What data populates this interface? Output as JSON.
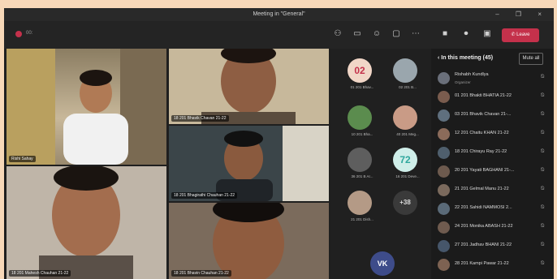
{
  "window": {
    "title": "Meeting in \"General\"",
    "controls": "– ❐ ×"
  },
  "toolbar": {
    "recording_label": "00:",
    "leave_label": "Leave"
  },
  "tiles": [
    {
      "name": "Rishi Sahay"
    },
    {
      "name": "18 201 Bhavik Chavan 21-22"
    },
    {
      "name": "18 201 Bhagirathi Chauhan 21-22"
    },
    {
      "name": "18 201 Mahesh Chauhan 21-22"
    },
    {
      "name": "18 201 Bhavin Chauhan 21-22"
    }
  ],
  "panel": [
    {
      "initials": "02",
      "label": "01 201 Bhav..."
    },
    {
      "initials": "",
      "label": "02 201 B..."
    },
    {
      "initials": "",
      "label": "10 201 Bha..."
    },
    {
      "initials": "",
      "label": "40 201 Meg..."
    },
    {
      "initials": "",
      "label": "36 201 B Ar..."
    },
    {
      "initials": "72",
      "label": "16 201 Deve..."
    },
    {
      "initials": "",
      "label": "21 201 Dish..."
    },
    {
      "initials": "+38",
      "label": ""
    },
    {
      "initials": "VK",
      "label": ""
    }
  ],
  "side": {
    "header": "In this meeting (45)",
    "mute_all": "Mute all",
    "people": [
      {
        "name": "Rishabh Kundlya",
        "sub": "Organizer"
      },
      {
        "name": "01 201 Bhakti BHATIA 21-22"
      },
      {
        "name": "03 201 Bhavik Chavan 21-..."
      },
      {
        "name": "12 201 Chaitu KHAN 21-22"
      },
      {
        "name": "18 201 Chirayu Ray 21-22"
      },
      {
        "name": "20 201 Yayati BAGHANI 21-..."
      },
      {
        "name": "21 201 Gelmal Manu 21-22"
      },
      {
        "name": "22 201 Sahidi NAMMOSI 2..."
      },
      {
        "name": "24 201 Monika ABASH 21-22"
      },
      {
        "name": "27 201 Jadhav BHANI 21-22"
      },
      {
        "name": "28 201 Kampi Pawar 21-22"
      }
    ]
  },
  "colors": {
    "accent": "#c4314b",
    "teal": "#2fa79d",
    "peach": "#f1d6c7"
  }
}
